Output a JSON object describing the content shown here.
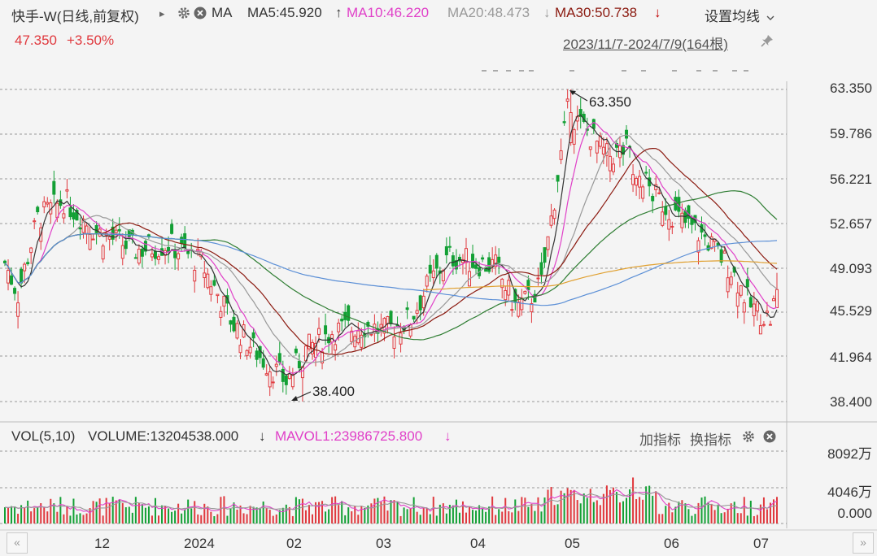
{
  "header": {
    "symbol": "快手-W(日线,前复权)",
    "play_glyph": "▸",
    "indicator": "MA",
    "ma5": "MA5:45.920",
    "ma5_arrow": "↑",
    "ma10": "MA10:46.220",
    "ma20": "MA20:48.473",
    "ma20_arrow": "↓",
    "ma30": "MA30:50.738",
    "ma30_arrow": "↓",
    "settings_label": "设置均线",
    "price": "47.350",
    "change": "+3.50%",
    "range": "2023/11/7-2024/7/9(164根)"
  },
  "price_axis": [
    "63.350",
    "59.786",
    "56.221",
    "52.657",
    "49.093",
    "45.529",
    "41.964",
    "38.400"
  ],
  "annotations": {
    "high": "63.350",
    "low": "38.400"
  },
  "volume_header": {
    "vol": "VOL(5,10)",
    "volume": "VOLUME:13204538.000",
    "volume_arrow": "↓",
    "mavol": "MAVOL1:23986725.800",
    "mavol_arrow": "↓",
    "add_indicator": "加指标",
    "switch_indicator": "换指标"
  },
  "volume_axis": [
    "8092万",
    "4046万",
    "0.000"
  ],
  "date_axis": [
    "12",
    "2024",
    "02",
    "03",
    "04",
    "05",
    "06",
    "07"
  ],
  "nav": {
    "left": "«",
    "right": "»"
  },
  "colors": {
    "up": "#e0393e",
    "down": "#13a035",
    "ma5": "#333333",
    "ma10": "#e040c8",
    "ma20": "#999999",
    "ma30": "#8b1a10",
    "ma60": "#2e7d32",
    "ma120": "#5b8fd6",
    "ma250": "#e0a030"
  },
  "icons": [
    "gear-icon",
    "close-icon",
    "pin-icon",
    "chevron-down-icon"
  ],
  "chart_data": {
    "type": "candlestick",
    "period": "2023/11/7-2024/7/9",
    "bars": 164,
    "ylim": [
      38.4,
      63.35
    ],
    "high": 63.35,
    "low": 38.4,
    "last_close": 47.35,
    "change_pct": 3.5,
    "months": [
      "12",
      "2024",
      "02",
      "03",
      "04",
      "05",
      "06",
      "07"
    ],
    "close_anchors": [
      [
        0,
        49.5
      ],
      [
        4,
        47.0
      ],
      [
        10,
        53.0
      ],
      [
        18,
        54.5
      ],
      [
        28,
        52.0
      ],
      [
        40,
        50.5
      ],
      [
        50,
        51.0
      ],
      [
        60,
        49.5
      ],
      [
        70,
        44.5
      ],
      [
        78,
        42.0
      ],
      [
        86,
        40.0
      ],
      [
        92,
        42.5
      ],
      [
        100,
        44.0
      ],
      [
        110,
        44.5
      ],
      [
        116,
        44.0
      ],
      [
        124,
        45.0
      ],
      [
        130,
        48.0
      ],
      [
        136,
        50.0
      ],
      [
        144,
        49.5
      ],
      [
        150,
        49.2
      ],
      [
        156,
        46.0
      ],
      [
        160,
        46.5
      ],
      [
        164,
        47.8
      ],
      [
        172,
        61.5
      ],
      [
        178,
        60.0
      ],
      [
        184,
        58.0
      ],
      [
        190,
        58.5
      ],
      [
        198,
        55.0
      ],
      [
        206,
        53.0
      ],
      [
        214,
        51.5
      ],
      [
        222,
        49.0
      ],
      [
        228,
        46.0
      ],
      [
        234,
        45.0
      ],
      [
        236,
        47.3
      ]
    ],
    "ma_lines": [
      {
        "name": "MA5",
        "value": 45.92
      },
      {
        "name": "MA10",
        "value": 46.22
      },
      {
        "name": "MA20",
        "value": 48.473
      },
      {
        "name": "MA30",
        "value": 50.738
      }
    ],
    "volume": {
      "ylim": [
        0,
        8092
      ],
      "unit": "万",
      "last": 1320.45,
      "mavol1": 2398.67
    }
  }
}
